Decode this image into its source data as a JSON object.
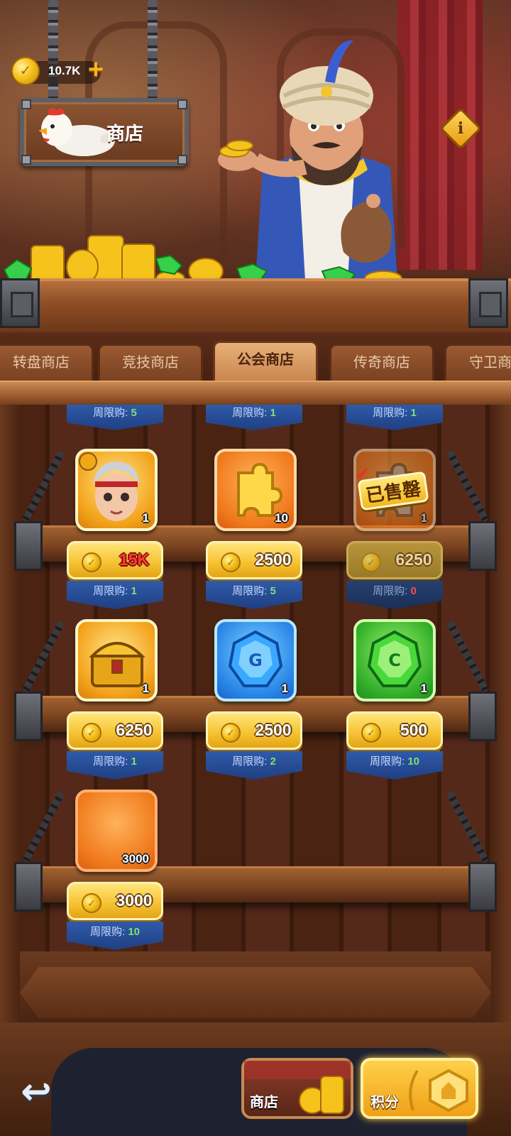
{
  "header": {
    "coin_balance": "10.7K",
    "coin_icon": "gold-coin-icon",
    "plus_icon": "plus-icon",
    "shop_sign": "商店",
    "info_icon": "info-icon"
  },
  "tabs": [
    {
      "label": "转盘商店",
      "active": false
    },
    {
      "label": "竞技商店",
      "active": false
    },
    {
      "label": "公会商店",
      "active": true
    },
    {
      "label": "传奇商店",
      "active": false
    },
    {
      "label": "守卫商店",
      "active": false
    }
  ],
  "top_limits": [
    {
      "label": "周限购: ",
      "count": "5"
    },
    {
      "label": "周限购: ",
      "count": "1"
    },
    {
      "label": "周限购: ",
      "count": "1"
    }
  ],
  "items": [
    {
      "name": "hero-portrait",
      "quantity": "1",
      "price": "15K",
      "price_insufficient": true,
      "limit_label": "周限购: ",
      "limit_count": "1",
      "sold": false
    },
    {
      "name": "gold-puzzle-piece",
      "quantity": "10",
      "price": "2500",
      "price_insufficient": false,
      "limit_label": "周限购: ",
      "limit_count": "5",
      "sold": false
    },
    {
      "name": "sold-out-item",
      "quantity": "1",
      "price": "6250",
      "price_insufficient": false,
      "limit_label": "周限购: ",
      "limit_count": "0",
      "sold": true,
      "sold_label": "已售罄"
    },
    {
      "name": "gold-treasure-chest",
      "quantity": "1",
      "price": "6250",
      "price_insufficient": false,
      "limit_label": "周限购: ",
      "limit_count": "1",
      "sold": false
    },
    {
      "name": "blue-gem",
      "quantity": "1",
      "price": "2500",
      "price_insufficient": false,
      "limit_label": "周限购: ",
      "limit_count": "2",
      "sold": false
    },
    {
      "name": "green-gem",
      "quantity": "1",
      "price": "500",
      "price_insufficient": false,
      "limit_label": "周限购: ",
      "limit_count": "10",
      "sold": false
    },
    {
      "name": "orange-item",
      "quantity": "3000",
      "price": "3000",
      "price_insufficient": false,
      "limit_label": "周限购: ",
      "limit_count": "10",
      "sold": false
    }
  ],
  "footer": {
    "back_icon": "back-arrow-icon",
    "shop_tab": "商店",
    "points_tab": "积分"
  },
  "colors": {
    "price_insufficient": "#ff3b30",
    "limit_count": "#7fe07a",
    "limit_zero": "#ff4b4b",
    "limit_banner": "#2f5aa8",
    "price_button": "#f7c435"
  }
}
